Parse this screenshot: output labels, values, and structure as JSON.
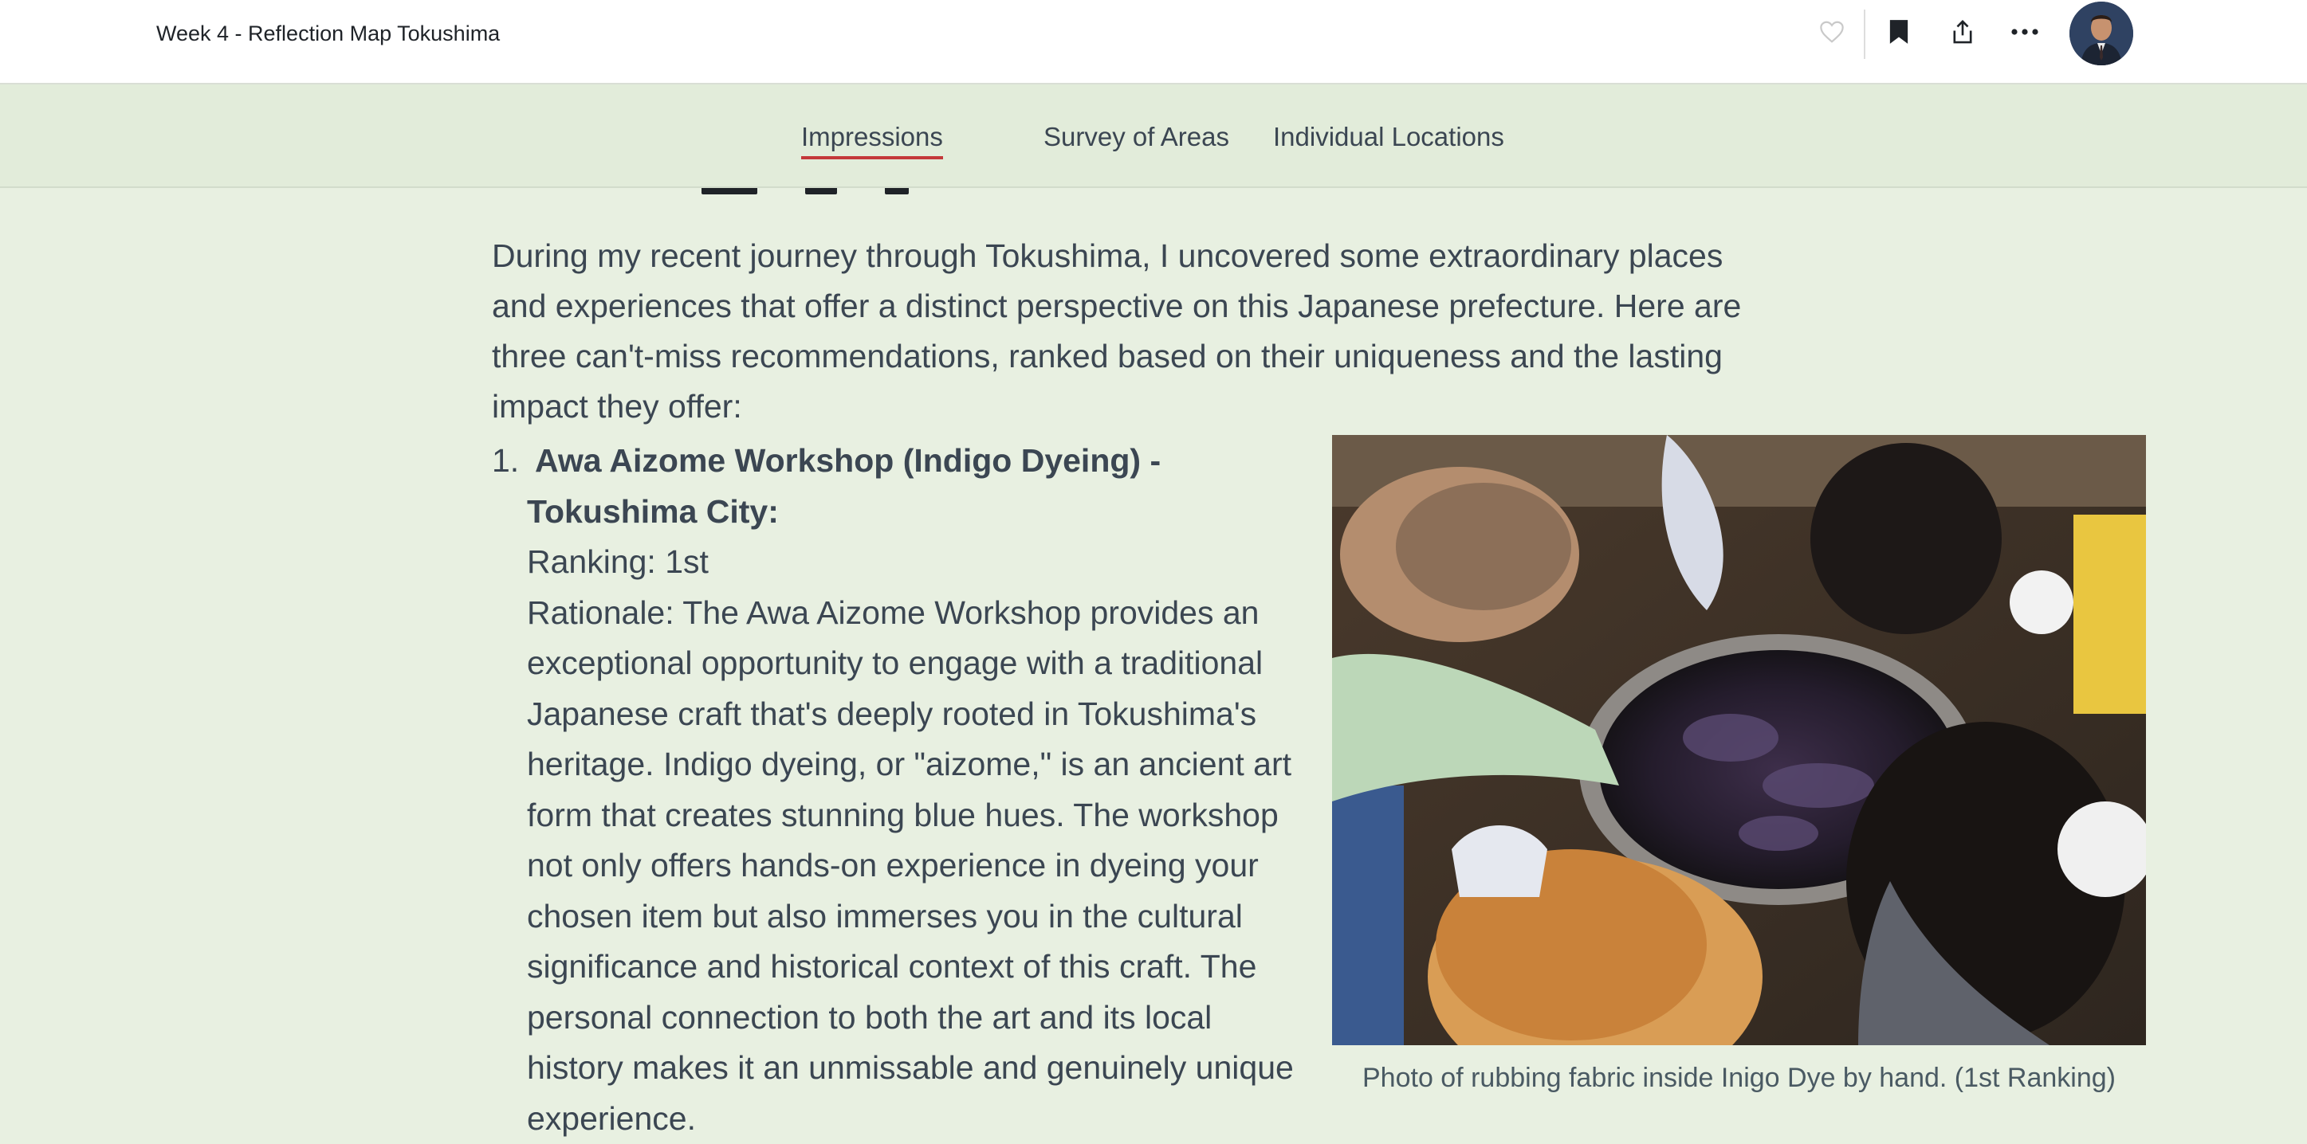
{
  "header": {
    "title": "Week 4 - Reflection Map Tokushima",
    "icons": [
      "heart-icon",
      "bookmark-icon",
      "share-icon",
      "more-icon"
    ]
  },
  "tabs": [
    {
      "label": "Impressions",
      "active": true
    },
    {
      "label": "Survey of Areas",
      "active": false
    },
    {
      "label": "Individual Locations",
      "active": false
    }
  ],
  "article": {
    "intro": "During my recent journey through Tokushima, I uncovered some extraordinary places and experiences that offer a distinct perspective on this Japanese prefecture. Here are three can't-miss recommendations, ranked based on their uniqueness and the lasting impact they offer:",
    "items": [
      {
        "number": "1.",
        "title": "Awa Aizome Workshop (Indigo Dyeing) - Tokushima City:",
        "ranking": "Ranking: 1st",
        "rationale": "Rationale: The Awa Aizome Workshop provides an exceptional opportunity to engage with a traditional Japanese craft that's deeply rooted in Tokushima's heritage. Indigo dyeing, or \"aizome,\" is an ancient art form that creates stunning blue hues. The workshop not only offers hands-on experience in dyeing your chosen item but also immerses you in the cultural significance and historical context of this craft. The personal connection to both the art and its local history makes it an unmissable and genuinely unique experience."
      }
    ],
    "photo_caption": "Photo of rubbing fabric inside Inigo Dye by hand. (1st Ranking)"
  },
  "colors": {
    "page_bg": "#e8f0e1",
    "tabs_bg": "#e2ecda",
    "active_tab_underline": "#c4383a",
    "text": "#3b4652"
  }
}
